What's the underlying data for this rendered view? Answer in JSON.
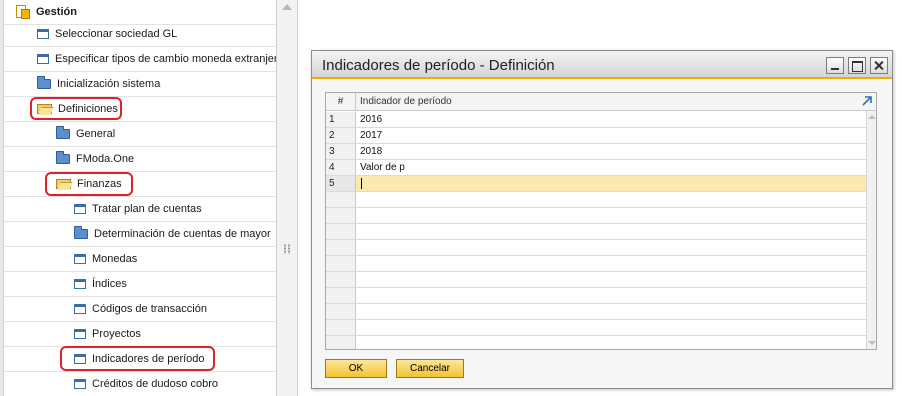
{
  "menu": {
    "header": "Gestión",
    "items": [
      {
        "label": "Seleccionar sociedad GL",
        "icon": "window-icon"
      },
      {
        "label": "Especificar tipos de cambio moneda extranjera",
        "icon": "window-icon"
      },
      {
        "label": "Inicialización sistema",
        "icon": "folder-icon"
      },
      {
        "label": "Definiciones",
        "icon": "folder-open-icon"
      },
      {
        "label": "General",
        "icon": "folder-icon"
      },
      {
        "label": "FModa.One",
        "icon": "folder-icon"
      },
      {
        "label": "Finanzas",
        "icon": "folder-open-icon"
      },
      {
        "label": "Tratar plan de cuentas",
        "icon": "window-icon"
      },
      {
        "label": "Determinación de cuentas de mayor",
        "icon": "folder-icon"
      },
      {
        "label": "Monedas",
        "icon": "window-icon"
      },
      {
        "label": "Índices",
        "icon": "window-icon"
      },
      {
        "label": "Códigos de transacción",
        "icon": "window-icon"
      },
      {
        "label": "Proyectos",
        "icon": "window-icon"
      },
      {
        "label": "Indicadores de período",
        "icon": "window-icon"
      },
      {
        "label": "Créditos de dudoso cobro",
        "icon": "window-icon"
      }
    ]
  },
  "dialog": {
    "title": "Indicadores de período - Definición",
    "grid": {
      "columns": [
        "#",
        "Indicador de período"
      ],
      "rows": [
        {
          "num": "1",
          "value": "2016"
        },
        {
          "num": "2",
          "value": "2017"
        },
        {
          "num": "3",
          "value": "2018"
        },
        {
          "num": "4",
          "value": "Valor de p"
        },
        {
          "num": "5",
          "value": ""
        }
      ]
    },
    "buttons": {
      "ok": "OK",
      "cancel": "Cancelar"
    }
  },
  "colors": {
    "accent": "#f0ab00",
    "highlight": "#e0212b",
    "active_row": "#fbeab0"
  }
}
